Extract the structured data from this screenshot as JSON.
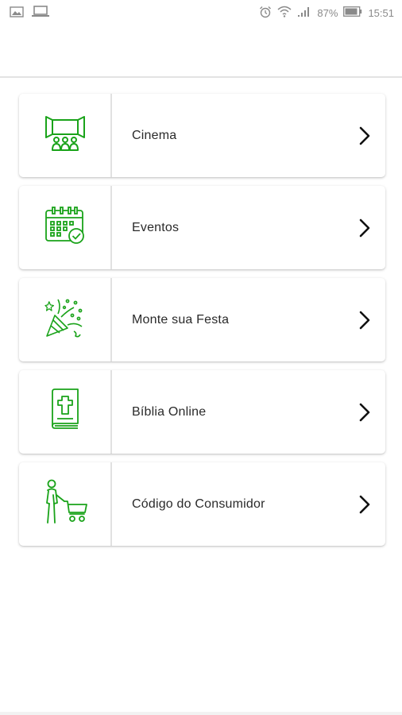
{
  "status_bar": {
    "battery": "87%",
    "time": "15:51",
    "icons_left": [
      "image-icon",
      "laptop-icon"
    ],
    "icons_right": [
      "alarm-icon",
      "wifi-icon",
      "signal-icon",
      "battery-icon"
    ]
  },
  "menu": {
    "items": [
      {
        "label": "Cinema",
        "icon": "cinema-icon"
      },
      {
        "label": "Eventos",
        "icon": "calendar-check-icon"
      },
      {
        "label": "Monte sua Festa",
        "icon": "party-popper-icon"
      },
      {
        "label": "Bíblia Online",
        "icon": "bible-icon"
      },
      {
        "label": "Código do Consumidor",
        "icon": "shopping-cart-person-icon"
      }
    ]
  },
  "colors": {
    "icon_green": "#1aa31a",
    "chevron": "#111111"
  }
}
